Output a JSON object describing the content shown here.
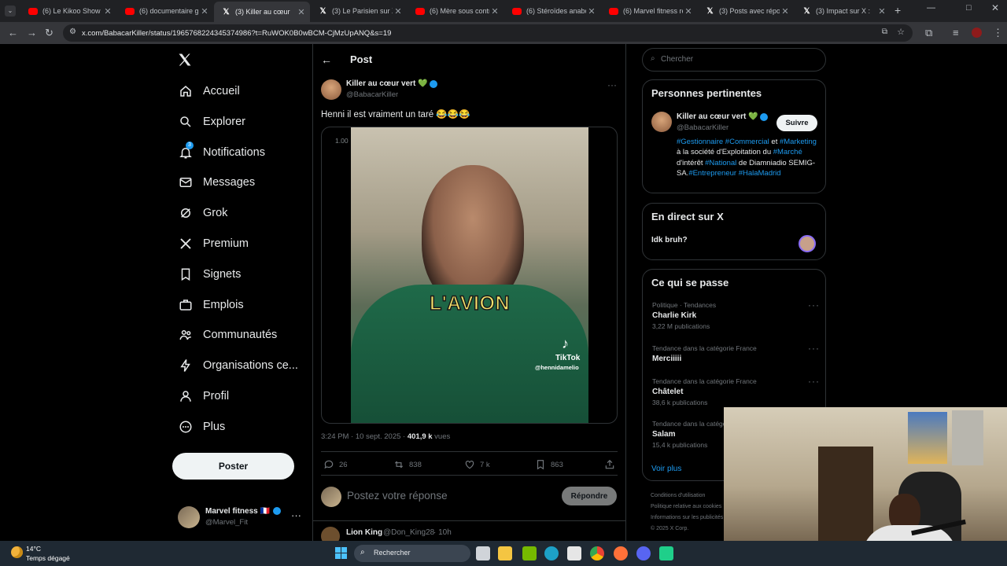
{
  "browser": {
    "tabs": [
      {
        "title": "(6) Le Kikoo Show - Y",
        "icon": "youtube-icon"
      },
      {
        "title": "(6) documentaire gpa",
        "icon": "youtube-icon"
      },
      {
        "title": "(3) Killer au cœur",
        "icon": "x-icon",
        "active": true
      },
      {
        "title": "(3) Le Parisien sur X",
        "icon": "x-icon"
      },
      {
        "title": "(6) Mère sous contra",
        "icon": "youtube-icon"
      },
      {
        "title": "(6) Stéroïdes anaboli",
        "icon": "youtube-icon"
      },
      {
        "title": "(6) Marvel fitness re",
        "icon": "youtube-icon"
      },
      {
        "title": "(3) Posts avec répons",
        "icon": "x-icon"
      },
      {
        "title": "(3) Impact sur X : ",
        "icon": "x-icon"
      }
    ],
    "new_tab": "+",
    "url": "x.com/BabacarKiller/status/1965768224345374986?t=RuWOK0B0wBCM-CjMzUpANQ&s=19"
  },
  "nav": {
    "items": [
      {
        "label": "Accueil",
        "icon": "home-icon"
      },
      {
        "label": "Explorer",
        "icon": "search-icon"
      },
      {
        "label": "Notifications",
        "icon": "bell-icon",
        "badge": "3"
      },
      {
        "label": "Messages",
        "icon": "mail-icon"
      },
      {
        "label": "Grok",
        "icon": "grok-icon"
      },
      {
        "label": "Premium",
        "icon": "x-logo-icon"
      },
      {
        "label": "Signets",
        "icon": "bookmark-icon"
      },
      {
        "label": "Emplois",
        "icon": "briefcase-icon"
      },
      {
        "label": "Communautés",
        "icon": "people-icon"
      },
      {
        "label": "Organisations ce...",
        "icon": "lightning-icon"
      },
      {
        "label": "Profil",
        "icon": "person-icon"
      },
      {
        "label": "Plus",
        "icon": "more-circle-icon"
      }
    ],
    "post_button": "Poster",
    "account": {
      "name": "Marvel fitness 🇫🇷",
      "handle": "@Marvel_Fit"
    }
  },
  "post": {
    "header": "Post",
    "author_name": "Killer au cœur vert 💚",
    "author_handle": "@BabacarKiller",
    "text": "Henni il est vraiment un taré 😂😂😂",
    "video": {
      "speed": "1.00",
      "caption": "L'AVION",
      "watermark_brand": "TikTok",
      "watermark_handle": "@hennidamelio"
    },
    "timestamp": "3:24 PM · 10 sept. 2025 · ",
    "views_count": "401,9 k",
    "views_label": " vues",
    "stats": {
      "replies": "26",
      "reposts": "838",
      "likes": "7 k",
      "bookmarks": "863"
    },
    "reply_placeholder": "Postez votre réponse",
    "reply_button": "Répondre",
    "next_reply": {
      "name": "Lion King",
      "handle": "@Don_King28",
      "time": "· 10h"
    }
  },
  "sidebar": {
    "search_placeholder": "Chercher",
    "relevant": {
      "title": "Personnes pertinentes",
      "name": "Killer au cœur vert 💚",
      "handle": "@BabacarKiller",
      "follow": "Suivre",
      "bio_parts": [
        {
          "t": "#Gestionnaire",
          "link": true
        },
        {
          "t": " ",
          "link": false
        },
        {
          "t": "#Commercial",
          "link": true
        },
        {
          "t": " et ",
          "link": false
        },
        {
          "t": "#Marketing",
          "link": true
        },
        {
          "t": " à la société d'Exploitation du ",
          "link": false
        },
        {
          "t": "#Marché",
          "link": true
        },
        {
          "t": " d'intérêt ",
          "link": false
        },
        {
          "t": "#National",
          "link": true
        },
        {
          "t": " de Diamniadio SEMIG-SA.",
          "link": false
        },
        {
          "t": "#Entrepreneur",
          "link": true
        },
        {
          "t": " ",
          "link": false
        },
        {
          "t": "#HalaMadrid",
          "link": true
        }
      ]
    },
    "live": {
      "title": "En direct sur X",
      "item": "Idk bruh?"
    },
    "trends": {
      "title": "Ce qui se passe",
      "items": [
        {
          "category": "Politique · Tendances",
          "name": "Charlie Kirk",
          "count": "3,22 M publications"
        },
        {
          "category": "Tendance dans la catégorie France",
          "name": "Merciiiii",
          "count": ""
        },
        {
          "category": "Tendance dans la catégorie France",
          "name": "Châtelet",
          "count": "38,6 k publications"
        },
        {
          "category": "Tendance dans la catégorie France",
          "name": "Salam",
          "count": "15,4 k publications"
        }
      ],
      "more": "Voir plus"
    },
    "footer": [
      "Conditions d'utilisation",
      "Politique relative aux cookies",
      "Informations sur les publicités",
      "© 2025 X Corp."
    ]
  },
  "taskbar": {
    "weather_temp": "14°C",
    "weather_desc": "Temps dégagé",
    "search_placeholder": "Rechercher"
  }
}
